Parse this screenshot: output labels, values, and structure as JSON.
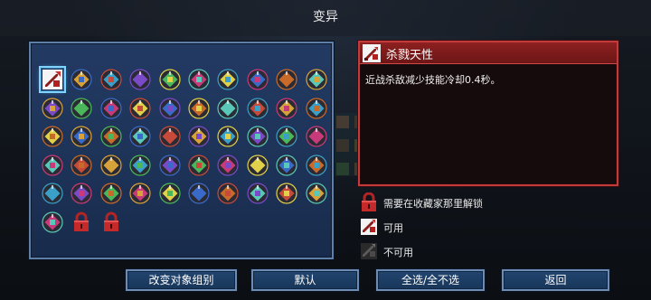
{
  "screen_title": "变异",
  "selected_mutation": {
    "name": "杀戮天性",
    "description": "近战杀敌减少技能冷却0.4秒。",
    "icon": "sword-kill-icon"
  },
  "mutation_grid": {
    "rows": [
      [
        {
          "icon": "sword-kill-icon",
          "state": "selected"
        },
        {
          "icon": "crossbow-icon",
          "state": "available"
        },
        {
          "icon": "flame-tower-icon",
          "state": "available"
        },
        {
          "icon": "sparkle-blade-icon",
          "state": "available"
        },
        {
          "icon": "crimson-rune-icon",
          "state": "available"
        },
        {
          "icon": "red-potion-icon",
          "state": "available"
        },
        {
          "icon": "green-spider-icon",
          "state": "available"
        },
        {
          "icon": "green-hand-icon",
          "state": "available"
        },
        {
          "icon": "blue-bottle-icon",
          "state": "available"
        },
        {
          "icon": "lightning-shield-icon",
          "state": "available"
        }
      ],
      [
        {
          "icon": "purple-hat-icon",
          "state": "available"
        },
        {
          "icon": "red-helmet-icon",
          "state": "available"
        },
        {
          "icon": "purple-orb-icon",
          "state": "available"
        },
        {
          "icon": "purple-fist-icon",
          "state": "available"
        },
        {
          "icon": "red-cross-icon",
          "state": "available"
        },
        {
          "icon": "twin-blades-icon",
          "state": "available"
        },
        {
          "icon": "green-figure-icon",
          "state": "available"
        },
        {
          "icon": "blue-wing-icon",
          "state": "available"
        },
        {
          "icon": "blue-eye-icon",
          "state": "available"
        },
        {
          "icon": "white-claw-icon",
          "state": "available"
        }
      ],
      [
        {
          "icon": "blue-crescent-icon",
          "state": "available"
        },
        {
          "icon": "blue-gear-icon",
          "state": "available"
        },
        {
          "icon": "sword-slash-icon",
          "state": "available"
        },
        {
          "icon": "purple-chest-icon",
          "state": "available"
        },
        {
          "icon": "purple-flask-icon",
          "state": "available"
        },
        {
          "icon": "skull-crossbones-icon",
          "state": "available"
        },
        {
          "icon": "blue-shield-icon",
          "state": "available"
        },
        {
          "icon": "green-leaf-icon",
          "state": "available"
        },
        {
          "icon": "green-clover-icon",
          "state": "available"
        },
        {
          "icon": "white-mask-icon",
          "state": "available"
        }
      ],
      [
        {
          "icon": "red-apple-icon",
          "state": "available"
        },
        {
          "icon": "yellow-arrow-icon",
          "state": "available"
        },
        {
          "icon": "green-hook-icon",
          "state": "available"
        },
        {
          "icon": "blue-castle-icon",
          "state": "available"
        },
        {
          "icon": "red-drop-icon",
          "state": "available"
        },
        {
          "icon": "fast-forward-icon",
          "state": "available"
        },
        {
          "icon": "green-book-icon",
          "state": "available"
        },
        {
          "icon": "red-swirl-icon",
          "state": "available"
        },
        {
          "icon": "green-snake-icon",
          "state": "available"
        },
        {
          "icon": "green-burst-icon",
          "state": "available"
        }
      ],
      [
        {
          "icon": "double-chevron-icon",
          "state": "available"
        },
        {
          "icon": "green-goblin-icon",
          "state": "available"
        },
        {
          "icon": "green-skull-icon",
          "state": "available"
        },
        {
          "icon": "ghost-mask-icon",
          "state": "available"
        },
        {
          "icon": "ice-crown-icon",
          "state": "available"
        },
        {
          "icon": "purple-rune-icon",
          "state": "available"
        },
        {
          "icon": "crossed-axes-icon",
          "state": "available"
        },
        {
          "icon": "gold-star-icon",
          "state": "available"
        },
        {
          "icon": "sword-strike-icon",
          "state": "available"
        },
        {
          "icon": "fire-axe-icon",
          "state": "available"
        }
      ],
      [
        {
          "icon": "yellow-lightning-icon",
          "state": "available"
        },
        {
          "icon": "red-padlock-icon",
          "state": "locked"
        },
        {
          "icon": "red-padlock-icon",
          "state": "locked"
        }
      ]
    ]
  },
  "legend": [
    {
      "icon": "red-padlock-icon",
      "label": "需要在收藏家那里解锁"
    },
    {
      "icon": "sword-available-icon",
      "label": "可用"
    },
    {
      "icon": "sword-unavailable-icon",
      "label": "不可用"
    }
  ],
  "buttons": {
    "change_group": "改变对象组别",
    "default": "默认",
    "select_all": "全选/全不选",
    "back": "返回"
  },
  "colors": {
    "grid_panel": "#1d3358",
    "grid_border": "#5d7fa8",
    "info_border": "#c23a3a",
    "info_header": "#7a1a1a",
    "selection": "#7fd3ff",
    "button_fill": "#1e3f66"
  }
}
